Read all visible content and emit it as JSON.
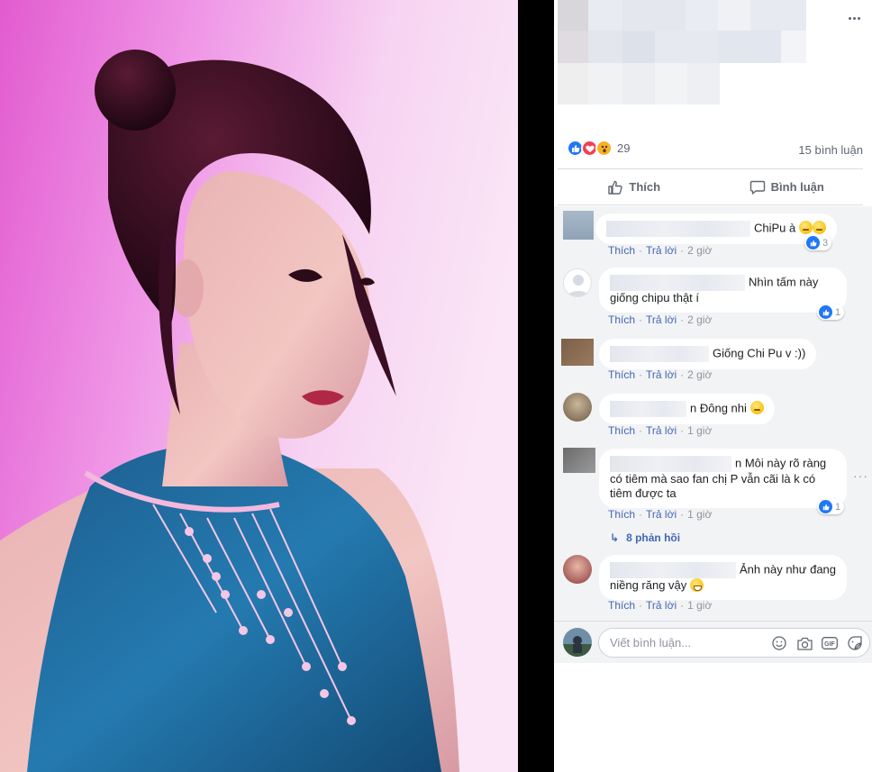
{
  "reactions": {
    "count": "29",
    "icons": [
      "like-icon",
      "love-icon",
      "wow-icon"
    ]
  },
  "comments_count": "15 bình luận",
  "actions": {
    "like": "Thích",
    "comment": "Bình luận"
  },
  "comment_meta": {
    "like": "Thích",
    "reply": "Trả lời"
  },
  "comments": [
    {
      "text": "ChiPu à",
      "emojis": 2,
      "time": "2 giờ",
      "likes": "3"
    },
    {
      "text": "Nhìn tấm này giống chipu thật í",
      "time": "2 giờ",
      "likes": "1"
    },
    {
      "text": "Giống Chi Pu v :))",
      "time": "2 giờ"
    },
    {
      "text": "n Đông nhi",
      "emojis": 1,
      "time": "1 giờ"
    },
    {
      "text": "n Môi này rõ ràng có tiêm mà sao fan chị P vẫn cãi là k có tiêm được ta",
      "time": "1 giờ",
      "likes": "1"
    },
    {
      "text": "Ảnh này như đang niềng răng vậy",
      "emojis": 1,
      "time": "1 giờ"
    }
  ],
  "replies_link": "8 phản hồi",
  "composer": {
    "placeholder": "Viết bình luận..."
  },
  "colors": {
    "fb_blue": "#4267b2",
    "like_blue": "#2078f4",
    "muted": "#90949c",
    "panel_bg": "#f2f3f5"
  }
}
